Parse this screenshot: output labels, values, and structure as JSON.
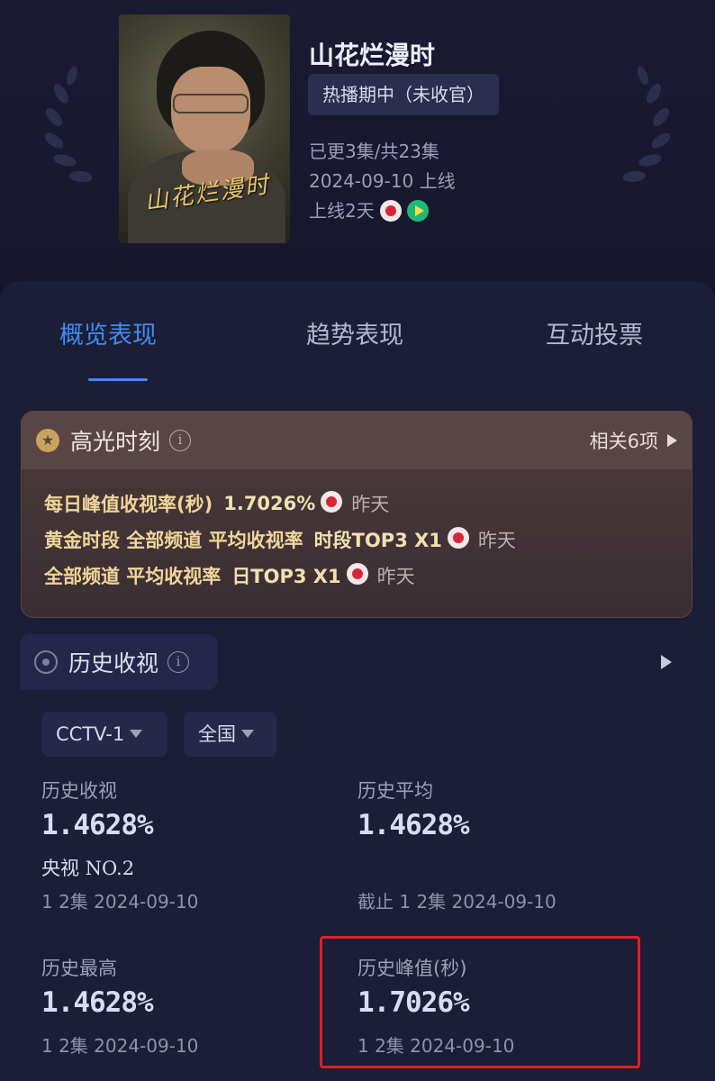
{
  "show": {
    "title": "山花烂漫时",
    "poster_title": "山花烂漫时",
    "status": "热播期中（未收官）",
    "episodes": "已更3集/共23集",
    "premiere": "2024-09-10 上线",
    "days_online": "上线2天"
  },
  "tabs": [
    {
      "label": "概览表现",
      "active": true
    },
    {
      "label": "趋势表现",
      "active": false
    },
    {
      "label": "互动投票",
      "active": false
    }
  ],
  "highlights": {
    "title": "高光时刻",
    "related": "相关6项",
    "rows": [
      {
        "label": "每日峰值收视率(秒)",
        "value": "1.7026%",
        "when": "昨天"
      },
      {
        "label": "黄金时段 全部频道 平均收视率",
        "value": "时段TOP3 X1",
        "when": "昨天"
      },
      {
        "label": "全部频道 平均收视率",
        "value": "日TOP3 X1",
        "when": "昨天"
      }
    ]
  },
  "history": {
    "title": "历史收视",
    "channel_select": "CCTV-1",
    "region_select": "全国",
    "stats": {
      "history_rating": {
        "label": "历史收视",
        "value": "1.4628%",
        "rank": "央视 NO.2",
        "sub": "1 2集 2024-09-10"
      },
      "history_avg": {
        "label": "历史平均",
        "value": "1.4628%",
        "sub": "截止 1 2集 2024-09-10"
      },
      "history_max": {
        "label": "历史最高",
        "value": "1.4628%",
        "sub": "1 2集 2024-09-10"
      },
      "history_peak": {
        "label": "历史峰值(秒)",
        "value": "1.7026%",
        "sub": "1 2集 2024-09-10"
      }
    }
  },
  "colors": {
    "accent": "#3f8cf2",
    "highlight_bg": "#4b3a3a",
    "annotation_red": "#e02020"
  }
}
